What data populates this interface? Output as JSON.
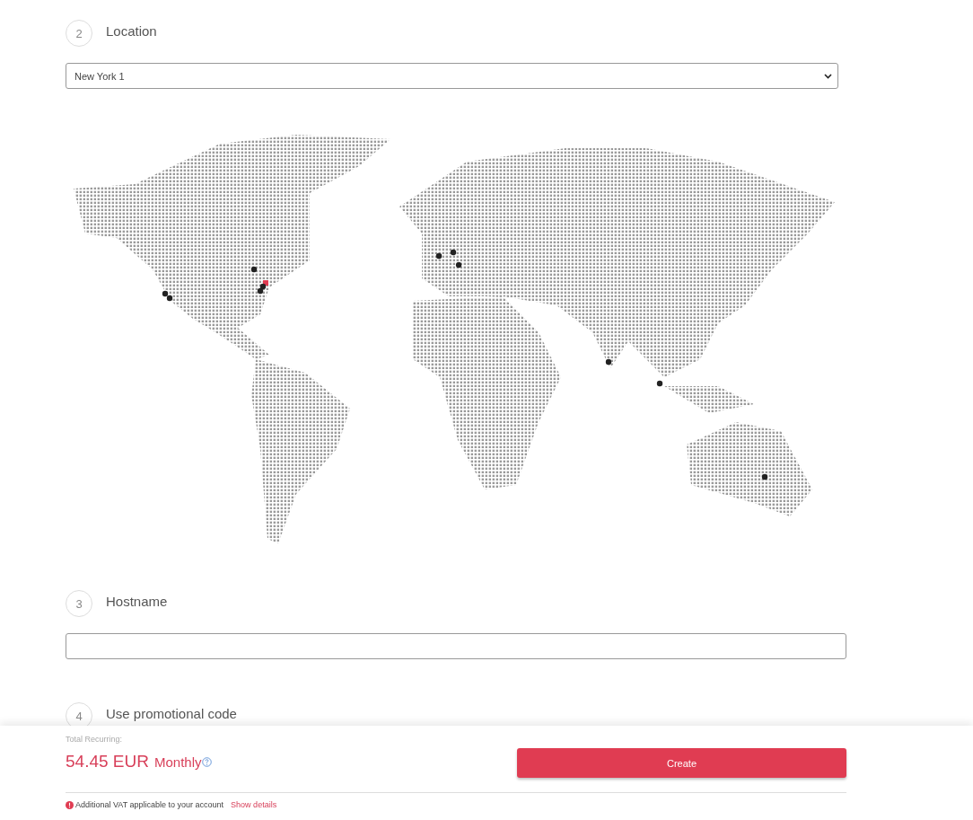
{
  "location_step": {
    "number": "2",
    "title": "Location",
    "select_value": "New York 1",
    "markers": [
      {
        "selected": false
      },
      {
        "selected": false
      },
      {
        "selected": false
      },
      {
        "selected": true
      },
      {
        "selected": false
      },
      {
        "selected": false
      },
      {
        "selected": false
      },
      {
        "selected": false
      },
      {
        "selected": false
      },
      {
        "selected": false
      },
      {
        "selected": false
      },
      {
        "selected": false
      }
    ]
  },
  "hostname_step": {
    "number": "3",
    "title": "Hostname"
  },
  "promo_step": {
    "number": "4",
    "title": "Use promotional code"
  },
  "footer": {
    "total_label": "Total Recurring:",
    "price": "54.45 EUR",
    "period": "Monthly",
    "button": "Create",
    "vat_notice": "Additional VAT applicable to your account",
    "vat_link": "Show details"
  }
}
